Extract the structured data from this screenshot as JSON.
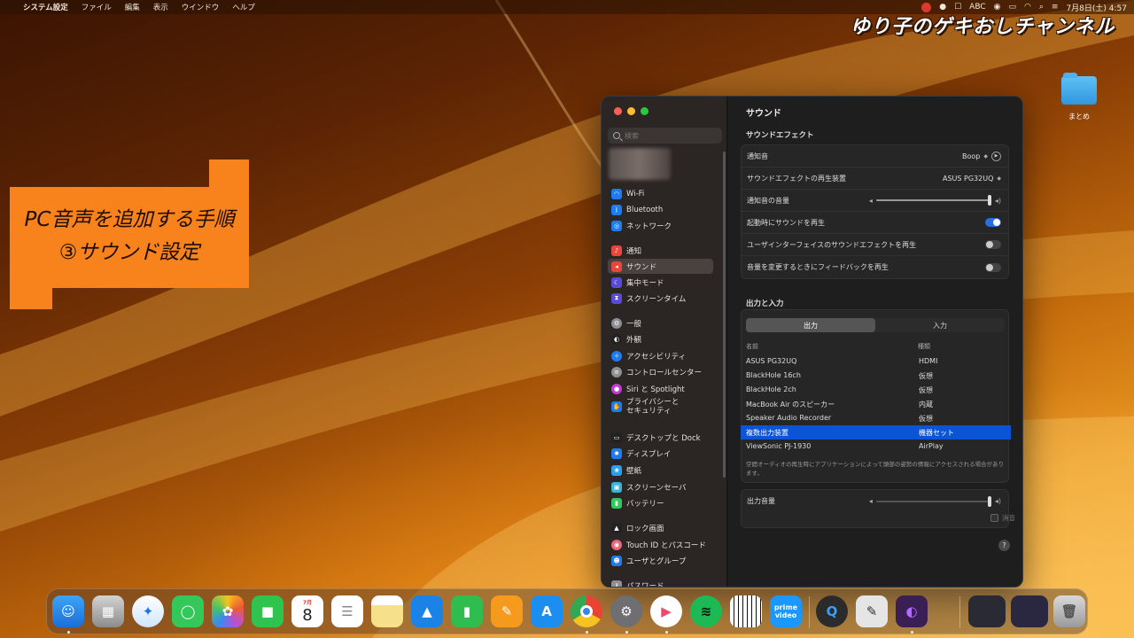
{
  "menubar": {
    "app_name": "システム設定",
    "items": [
      "ファイル",
      "編集",
      "表示",
      "ウインドウ",
      "ヘルプ"
    ],
    "input_mode": "ABC",
    "clock": "7月8日(土) 4:57"
  },
  "overlay": {
    "channel_title": "ゆり子のゲキおしチャンネル",
    "caption_line1": "PC音声を追加する手順",
    "caption_line2": "③サウンド設定"
  },
  "desktop": {
    "folder_label": "まとめ"
  },
  "sidebar": {
    "search_placeholder": "検索",
    "items": [
      {
        "label": "Wi-Fi",
        "icon": "wifi-icon",
        "color": "#1e7cf0"
      },
      {
        "label": "Bluetooth",
        "icon": "bluetooth-icon",
        "color": "#1e7cf0"
      },
      {
        "label": "ネットワーク",
        "icon": "globe-icon",
        "color": "#1e7cf0"
      },
      {
        "label": "通知",
        "icon": "bell-icon",
        "color": "#e8453c"
      },
      {
        "label": "サウンド",
        "icon": "speaker-icon",
        "color": "#e8453c"
      },
      {
        "label": "集中モード",
        "icon": "moon-icon",
        "color": "#5a4bd6"
      },
      {
        "label": "スクリーンタイム",
        "icon": "hourglass-icon",
        "color": "#5a4bd6"
      },
      {
        "label": "一般",
        "icon": "gear-icon",
        "color": "#8e8e93"
      },
      {
        "label": "外観",
        "icon": "appearance-icon",
        "color": "#222222"
      },
      {
        "label": "アクセシビリティ",
        "icon": "accessibility-icon",
        "color": "#1e7cf0"
      },
      {
        "label": "コントロールセンター",
        "icon": "control-center-icon",
        "color": "#8e8e93"
      },
      {
        "label": "Siri と Spotlight",
        "icon": "siri-icon",
        "color": "#c23bd4"
      },
      {
        "label": "プライバシーと\nセキュリティ",
        "icon": "hand-icon",
        "color": "#1e7cf0"
      },
      {
        "label": "デスクトップと Dock",
        "icon": "dock-icon",
        "color": "#222222"
      },
      {
        "label": "ディスプレイ",
        "icon": "sun-icon",
        "color": "#1e7cf0"
      },
      {
        "label": "壁紙",
        "icon": "wallpaper-icon",
        "color": "#2aa0e8"
      },
      {
        "label": "スクリーンセーバ",
        "icon": "screensaver-icon",
        "color": "#3ab3d8"
      },
      {
        "label": "バッテリー",
        "icon": "battery-icon",
        "color": "#34c759"
      },
      {
        "label": "ロック画面",
        "icon": "lock-icon",
        "color": "#222222"
      },
      {
        "label": "Touch ID とパスコード",
        "icon": "fingerprint-icon",
        "color": "#e8667a"
      },
      {
        "label": "ユーザとグループ",
        "icon": "users-icon",
        "color": "#1e7cf0"
      },
      {
        "label": "パスワード",
        "icon": "key-icon",
        "color": "#8e8e93"
      }
    ]
  },
  "content": {
    "title": "サウンド",
    "effects_section": "サウンドエフェクト",
    "alert_sound_label": "通知音",
    "alert_sound_value": "Boop",
    "effects_device_label": "サウンドエフェクトの再生装置",
    "effects_device_value": "ASUS PG32UQ",
    "alert_volume_label": "通知音の音量",
    "alert_volume": 1.0,
    "startup_label": "起動時にサウンドを再生",
    "startup_on": true,
    "ui_effects_label": "ユーザインターフェイスのサウンドエフェクトを再生",
    "ui_effects_on": false,
    "feedback_label": "音量を変更するときにフィードバックを再生",
    "feedback_on": false,
    "io_section": "出力と入力",
    "tabs": [
      "出力",
      "入力"
    ],
    "col_name": "名前",
    "col_type": "種類",
    "devices": [
      {
        "name": "ASUS PG32UQ",
        "type": "HDMI"
      },
      {
        "name": "BlackHole 16ch",
        "type": "仮想"
      },
      {
        "name": "BlackHole 2ch",
        "type": "仮想"
      },
      {
        "name": "MacBook Air のスピーカー",
        "type": "内蔵"
      },
      {
        "name": "Speaker Audio Recorder",
        "type": "仮想"
      },
      {
        "name": "複数出力装置",
        "type": "機器セット"
      },
      {
        "name": "ViewSonic PJ-1930",
        "type": "AirPlay"
      }
    ],
    "note": "空間オーディオの再生時にアプリケーションによって頭部の姿勢の情報にアクセスされる場合があります。",
    "output_volume_label": "出力音量",
    "mute_label": "消音",
    "help": "?"
  },
  "dock": {
    "calendar_month": "7月",
    "calendar_day": "8"
  }
}
